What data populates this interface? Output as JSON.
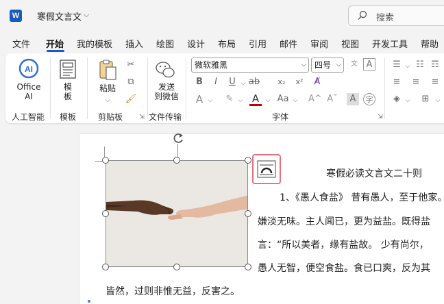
{
  "app": {
    "icon_letter": "W",
    "doc_title": "寒假文言文",
    "search_placeholder": "搜索"
  },
  "tabs": [
    "文件",
    "开始",
    "我的模板",
    "插入",
    "绘图",
    "设计",
    "布局",
    "引用",
    "邮件",
    "审阅",
    "视图",
    "开发工具",
    "帮助"
  ],
  "active_tab": "开始",
  "ribbon": {
    "ai": {
      "label_line1": "Office",
      "label_line2": "AI",
      "ai_glyph": "AI",
      "group": "人工智能"
    },
    "template": {
      "label_line1": "模",
      "label_line2": "板",
      "group": "模板"
    },
    "clipboard": {
      "paste_line1": "粘贴",
      "group": "剪贴板"
    },
    "file_transfer": {
      "label_line1": "发送",
      "label_line2": "到微信",
      "group": "文件传输"
    },
    "font": {
      "font_name": "微软雅黑",
      "font_size": "四号",
      "group": "字体",
      "wen_glyph": "文",
      "a_glyph": "A"
    }
  },
  "document": {
    "heading": "寒假必读文言文二十则",
    "lines": [
      "1、《愚人食盐》 昔有愚人，至于他家。",
      "嫌淡无味。主人闻已，更为益盐。既得盐",
      "言：“所以美者，缘有盐故。 少有尚尔，",
      "愚人无智，便空食盐。食已口爽，反为其",
      "皆然，过则非惟无益，反害之。"
    ]
  },
  "colors": {
    "accent": "#185abd",
    "layout_button_border": "#e8707f",
    "font_color": "#c00000"
  }
}
